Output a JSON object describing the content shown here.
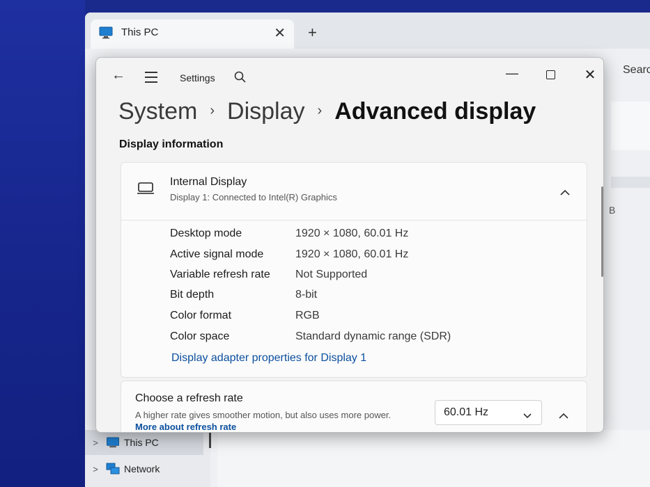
{
  "explorer": {
    "tab_title": "This PC",
    "tab_close": "✕",
    "new_tab": "+",
    "search_partial": "Searc",
    "side_char": "B",
    "nav": [
      {
        "label": "This PC"
      },
      {
        "label": "Network"
      }
    ]
  },
  "settings": {
    "app_title": "Settings",
    "window": {
      "minimize": "—",
      "close": "✕"
    },
    "breadcrumb": [
      "System",
      "Display"
    ],
    "breadcrumb_separator": "›",
    "page_title": "Advanced display",
    "section_title": "Display information",
    "display_card": {
      "title": "Internal Display",
      "subtitle": "Display 1: Connected to Intel(R) Graphics",
      "rows": [
        {
          "label": "Desktop mode",
          "value": "1920 × 1080, 60.01 Hz"
        },
        {
          "label": "Active signal mode",
          "value": "1920 × 1080, 60.01 Hz"
        },
        {
          "label": "Variable refresh rate",
          "value": "Not Supported"
        },
        {
          "label": "Bit depth",
          "value": "8-bit"
        },
        {
          "label": "Color format",
          "value": "RGB"
        },
        {
          "label": "Color space",
          "value": "Standard dynamic range (SDR)"
        }
      ],
      "link": "Display adapter properties for Display 1"
    },
    "refresh_card": {
      "title": "Choose a refresh rate",
      "description": "A higher rate gives smoother motion, but also uses more power.",
      "link": "More about refresh rate",
      "selected": "60.01 Hz"
    }
  },
  "colors": {
    "accent_link": "#0b4f9e",
    "desktop": "#1a2a8c"
  },
  "icons": [
    "pc-icon",
    "back-arrow-icon",
    "hamburger-menu-icon",
    "search-icon",
    "minimize-icon",
    "maximize-icon",
    "close-icon",
    "laptop-icon",
    "chevron-up-icon",
    "chevron-down-icon",
    "chevron-right-icon",
    "network-icon"
  ]
}
